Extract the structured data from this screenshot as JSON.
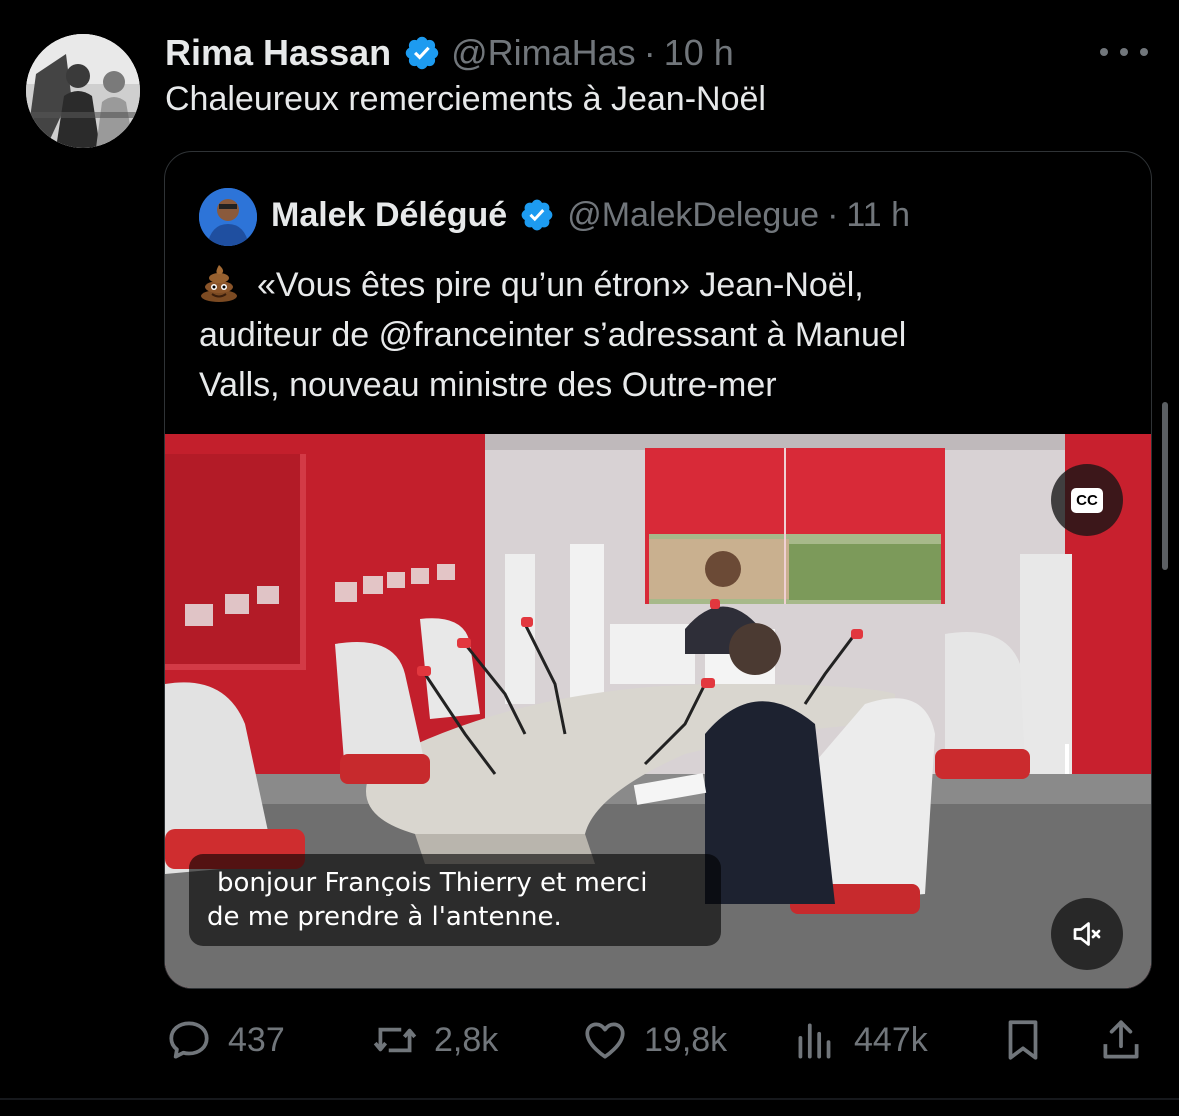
{
  "tweet": {
    "author_name": "Rima Hassan",
    "handle": "@RimaHas",
    "separator": "·",
    "time": "10 h",
    "text": "Chaleureux remerciements à Jean-Noël"
  },
  "quoted": {
    "author_name": "Malek Délégué",
    "handle": "@MalekDelegue",
    "separator": "·",
    "time": "11 h",
    "text_line1": "«Vous êtes pire qu’un étron» Jean-Noël,",
    "text_line2": "auditeur de @franceinter s’adressant à Manuel",
    "text_line3": "Valls, nouveau ministre des Outre-mer",
    "emoji": "pile-of-poo-icon"
  },
  "video": {
    "cc_label": "CC",
    "caption_line1": "bonjour François Thierry et merci",
    "caption_line2": "de me prendre à l'antenne.",
    "muted": true
  },
  "actions": {
    "replies": "437",
    "reposts": "2,8k",
    "likes": "19,8k",
    "views": "447k"
  },
  "colors": {
    "background": "#000000",
    "text": "#e7e9ea",
    "secondary": "#71767b",
    "verified": "#1d9bf0",
    "studio_red": "#c8202e"
  }
}
